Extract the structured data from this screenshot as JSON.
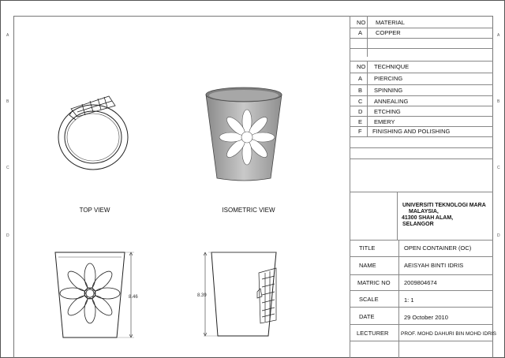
{
  "zones_left": [
    "A",
    "B",
    "C",
    "D"
  ],
  "materials": {
    "header": {
      "no": "NO",
      "label": "MATERIAL"
    },
    "rows": [
      {
        "no": "A",
        "label": "COPPER"
      }
    ]
  },
  "techniques": {
    "header": {
      "no": "NO",
      "label": "TECHNIQUE"
    },
    "rows": [
      {
        "no": "A",
        "label": "PIERCING"
      },
      {
        "no": "B",
        "label": "SPINNING"
      },
      {
        "no": "C",
        "label": "ANNEALING"
      },
      {
        "no": "D",
        "label": "ETCHING"
      },
      {
        "no": "E",
        "label": "EMERY"
      },
      {
        "no": "F",
        "label": "FINISHING AND POLISHING"
      }
    ]
  },
  "institution": {
    "line1": "UNIVERSITI TEKNOLOGI MARA",
    "line2": "MALAYSIA,",
    "line3": "41300 SHAH ALAM,",
    "line4": "SELANGOR"
  },
  "title_block": [
    {
      "key": "TITLE",
      "value": "OPEN CONTAINER (OC)"
    },
    {
      "key": "NAME",
      "value": "AEISYAH BINTI IDRIS"
    },
    {
      "key": "MATRIC NO",
      "value": "2009804674"
    },
    {
      "key": "SCALE",
      "value": "1: 1"
    },
    {
      "key": "DATE",
      "value": "29 October 2010"
    },
    {
      "key": "LECTURER",
      "value": "PROF. MOHD DAHURI BIN MOHD IDRIS"
    }
  ],
  "views": {
    "top": "TOP VIEW",
    "isometric": "ISOMETRIC VIEW"
  },
  "dimensions": {
    "front_height": "8.46",
    "side_height": "8.39"
  },
  "colors": {
    "line": "#222222",
    "grid": "#888888",
    "shade": "#9a9a9a"
  }
}
